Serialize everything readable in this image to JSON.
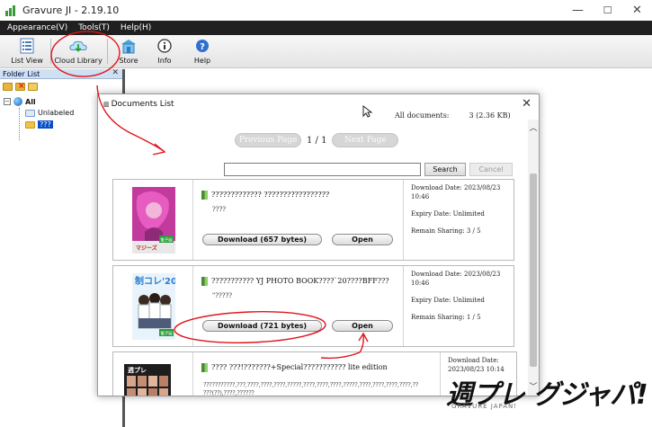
{
  "window": {
    "title": "Gravure JI - 2.19.10",
    "controls": {
      "minimize": "—",
      "maximize": "☐",
      "close": "✕"
    }
  },
  "menu": [
    "Appearance(V)",
    "Tools(T)",
    "Help(H)"
  ],
  "toolbar": {
    "list_view": "List View",
    "cloud_library": "Cloud Library",
    "store": "Store",
    "info": "Info",
    "help": "Help"
  },
  "folder_panel": {
    "title": "Folder List",
    "close": "✕",
    "tree": {
      "all": "All",
      "expander": "−",
      "unlabeled": "Unlabeled",
      "selected_folder": "???"
    }
  },
  "dialog": {
    "title": "Documents List",
    "close": "✕",
    "all_documents_label": "All documents:",
    "all_documents_value": "3  (2.36 KB)",
    "pager": {
      "prev": "Previous Page",
      "page": "1 / 1",
      "next": "Next Page"
    },
    "search": {
      "value": "",
      "placeholder": "",
      "search_label": "Search",
      "cancel_label": "Cancel"
    },
    "scroll": {
      "up": "︿",
      "down": "﹀"
    },
    "documents": [
      {
        "title": "????????????? ?????????????????",
        "subtitle": "????",
        "download_label": "Download (657 bytes)",
        "open_label": "Open",
        "download_date": "Download Date: 2023/08/23",
        "download_time": "10:46",
        "expiry": "Expiry Date: Unlimited",
        "remain": "Remain Sharing: 3 / 5"
      },
      {
        "title": "??????????? YJ PHOTO BOOK????`20????BFF???",
        "subtitle": "\"?????",
        "download_label": "Download (721 bytes)",
        "open_label": "Open",
        "download_date": "Download Date: 2023/08/23",
        "download_time": "10:46",
        "expiry": "Expiry Date: Unlimited",
        "remain": "Remain Sharing: 1 / 5"
      },
      {
        "title": "???? ???!???????+Special??????????? lite edition",
        "subtitle": "???????????,???,????,????,????,?????,????,????,????,?????,????,????,????,????,??",
        "subtitle2": "???(??),????,??????",
        "download_date": "Download Date:",
        "download_time": "2023/08/23 10:14"
      }
    ]
  },
  "covers": [
    {
      "badge": "電子版",
      "caption": "マジーズ"
    },
    {
      "headline": "制コレ'20",
      "badge": "電子版"
    },
    {
      "headline": "週プレ"
    }
  ],
  "watermark": {
    "main": "週プレ グジャパ!",
    "sub": "GRAVURE JAPAN!"
  },
  "colors": {
    "menubar": "#202020",
    "accent_folder": "#0a4fc7",
    "annotation_red": "#e0141c",
    "app_icon_green": "#3a9a3a"
  }
}
